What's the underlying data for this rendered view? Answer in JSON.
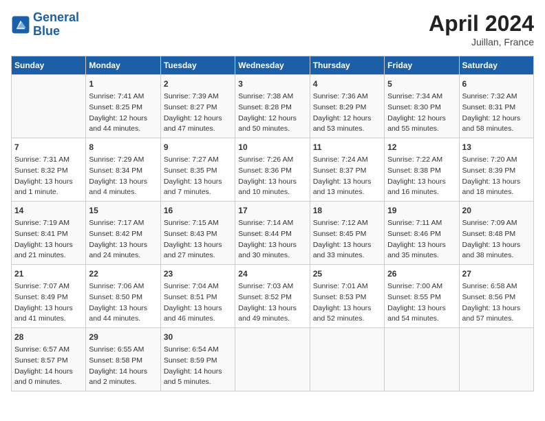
{
  "header": {
    "logo_line1": "General",
    "logo_line2": "Blue",
    "title": "April 2024",
    "subtitle": "Juillan, France"
  },
  "columns": [
    "Sunday",
    "Monday",
    "Tuesday",
    "Wednesday",
    "Thursday",
    "Friday",
    "Saturday"
  ],
  "weeks": [
    [
      {
        "day": "",
        "info": ""
      },
      {
        "day": "1",
        "info": "Sunrise: 7:41 AM\nSunset: 8:25 PM\nDaylight: 12 hours\nand 44 minutes."
      },
      {
        "day": "2",
        "info": "Sunrise: 7:39 AM\nSunset: 8:27 PM\nDaylight: 12 hours\nand 47 minutes."
      },
      {
        "day": "3",
        "info": "Sunrise: 7:38 AM\nSunset: 8:28 PM\nDaylight: 12 hours\nand 50 minutes."
      },
      {
        "day": "4",
        "info": "Sunrise: 7:36 AM\nSunset: 8:29 PM\nDaylight: 12 hours\nand 53 minutes."
      },
      {
        "day": "5",
        "info": "Sunrise: 7:34 AM\nSunset: 8:30 PM\nDaylight: 12 hours\nand 55 minutes."
      },
      {
        "day": "6",
        "info": "Sunrise: 7:32 AM\nSunset: 8:31 PM\nDaylight: 12 hours\nand 58 minutes."
      }
    ],
    [
      {
        "day": "7",
        "info": "Sunrise: 7:31 AM\nSunset: 8:32 PM\nDaylight: 13 hours\nand 1 minute."
      },
      {
        "day": "8",
        "info": "Sunrise: 7:29 AM\nSunset: 8:34 PM\nDaylight: 13 hours\nand 4 minutes."
      },
      {
        "day": "9",
        "info": "Sunrise: 7:27 AM\nSunset: 8:35 PM\nDaylight: 13 hours\nand 7 minutes."
      },
      {
        "day": "10",
        "info": "Sunrise: 7:26 AM\nSunset: 8:36 PM\nDaylight: 13 hours\nand 10 minutes."
      },
      {
        "day": "11",
        "info": "Sunrise: 7:24 AM\nSunset: 8:37 PM\nDaylight: 13 hours\nand 13 minutes."
      },
      {
        "day": "12",
        "info": "Sunrise: 7:22 AM\nSunset: 8:38 PM\nDaylight: 13 hours\nand 16 minutes."
      },
      {
        "day": "13",
        "info": "Sunrise: 7:20 AM\nSunset: 8:39 PM\nDaylight: 13 hours\nand 18 minutes."
      }
    ],
    [
      {
        "day": "14",
        "info": "Sunrise: 7:19 AM\nSunset: 8:41 PM\nDaylight: 13 hours\nand 21 minutes."
      },
      {
        "day": "15",
        "info": "Sunrise: 7:17 AM\nSunset: 8:42 PM\nDaylight: 13 hours\nand 24 minutes."
      },
      {
        "day": "16",
        "info": "Sunrise: 7:15 AM\nSunset: 8:43 PM\nDaylight: 13 hours\nand 27 minutes."
      },
      {
        "day": "17",
        "info": "Sunrise: 7:14 AM\nSunset: 8:44 PM\nDaylight: 13 hours\nand 30 minutes."
      },
      {
        "day": "18",
        "info": "Sunrise: 7:12 AM\nSunset: 8:45 PM\nDaylight: 13 hours\nand 33 minutes."
      },
      {
        "day": "19",
        "info": "Sunrise: 7:11 AM\nSunset: 8:46 PM\nDaylight: 13 hours\nand 35 minutes."
      },
      {
        "day": "20",
        "info": "Sunrise: 7:09 AM\nSunset: 8:48 PM\nDaylight: 13 hours\nand 38 minutes."
      }
    ],
    [
      {
        "day": "21",
        "info": "Sunrise: 7:07 AM\nSunset: 8:49 PM\nDaylight: 13 hours\nand 41 minutes."
      },
      {
        "day": "22",
        "info": "Sunrise: 7:06 AM\nSunset: 8:50 PM\nDaylight: 13 hours\nand 44 minutes."
      },
      {
        "day": "23",
        "info": "Sunrise: 7:04 AM\nSunset: 8:51 PM\nDaylight: 13 hours\nand 46 minutes."
      },
      {
        "day": "24",
        "info": "Sunrise: 7:03 AM\nSunset: 8:52 PM\nDaylight: 13 hours\nand 49 minutes."
      },
      {
        "day": "25",
        "info": "Sunrise: 7:01 AM\nSunset: 8:53 PM\nDaylight: 13 hours\nand 52 minutes."
      },
      {
        "day": "26",
        "info": "Sunrise: 7:00 AM\nSunset: 8:55 PM\nDaylight: 13 hours\nand 54 minutes."
      },
      {
        "day": "27",
        "info": "Sunrise: 6:58 AM\nSunset: 8:56 PM\nDaylight: 13 hours\nand 57 minutes."
      }
    ],
    [
      {
        "day": "28",
        "info": "Sunrise: 6:57 AM\nSunset: 8:57 PM\nDaylight: 14 hours\nand 0 minutes."
      },
      {
        "day": "29",
        "info": "Sunrise: 6:55 AM\nSunset: 8:58 PM\nDaylight: 14 hours\nand 2 minutes."
      },
      {
        "day": "30",
        "info": "Sunrise: 6:54 AM\nSunset: 8:59 PM\nDaylight: 14 hours\nand 5 minutes."
      },
      {
        "day": "",
        "info": ""
      },
      {
        "day": "",
        "info": ""
      },
      {
        "day": "",
        "info": ""
      },
      {
        "day": "",
        "info": ""
      }
    ]
  ]
}
